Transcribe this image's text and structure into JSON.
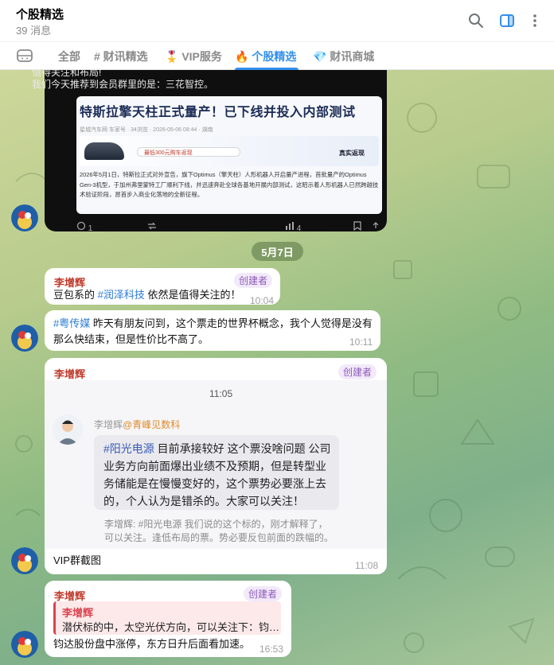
{
  "header": {
    "title": "个股精选",
    "subtitle": "39 消息"
  },
  "tabs": [
    {
      "label": "全部"
    },
    {
      "label": "# 财讯精选"
    },
    {
      "label": "🎖️ VIP服务"
    },
    {
      "label": "🔥 个股精选"
    },
    {
      "label": "💎 财讯商城"
    }
  ],
  "dark_post": {
    "line1": "值得关注和布局!",
    "line2": "我们今天推荐到会员群里的是：三花智控。",
    "article_title": "特斯拉擎天柱正式量产！已下线并投入内部测试",
    "article_meta": "星城汽车网  车家号 · 34浏览 · 2026-05-06 08:44 · 湖南",
    "article_body": "2026年5月1日，特斯拉正式对外宣告，旗下Optimus（擎天柱）人形机器人开启量产进程，首批量产的Optimus Gen-3机型，于加州弗里蒙特工厂顺利下线，并迅速奔赴全球各基地开展内部测试，这昭示着人形机器人已然跨越技术验证阶段，昂首步入商业化落地的全新征程。",
    "search_text": "最低300元购车返现",
    "brand_text": "真实返现",
    "reply_count": "1",
    "views_count": "4"
  },
  "date_divider": "5月7日",
  "messages": [
    {
      "sender": "李增辉",
      "badge": "创建者",
      "tag": "#润泽科技",
      "text_pre": "豆包系的 ",
      "text_post": " 依然是值得关注的！",
      "time": "10:04"
    },
    {
      "tag": "#粤传媒",
      "text": " 昨天有朋友问到，这个票走的世界杯概念，我个人觉得是没有那么快结束，但是性价比不高了。",
      "time": "10:11"
    },
    {
      "sender": "李增辉",
      "badge": "创建者",
      "forward_time": "11:05",
      "forward_author": "李增辉",
      "forward_org": "@青峰见数科",
      "quote_tag": "#阳光电源",
      "quote_text": " 目前承接较好 这个票没啥问题 公司业务方向前面爆出业绩不及预期，但是转型业务储能是在慢慢变好的，这个票势必要涨上去的，个人认为是错杀的。大家可以关注！",
      "sub_text": "李增辉: #阳光电源 我们说的这个标的，刚才解释了，可以关注。逢低布局的票。势必要反包前面的跌幅的。",
      "caption": "VIP群截图",
      "time": "11:08"
    },
    {
      "sender": "李增辉",
      "badge": "创建者",
      "reply_name": "李增辉",
      "reply_text": "潜伏标的中，太空光伏方向，可以关注下：钧…",
      "text": "钧达股份盘中涨停，东方日升后面看加速。",
      "time": "16:53"
    }
  ],
  "colors": {
    "accent": "#3390ec",
    "sender": "#c0392b",
    "badge": "#8e5bb8"
  }
}
